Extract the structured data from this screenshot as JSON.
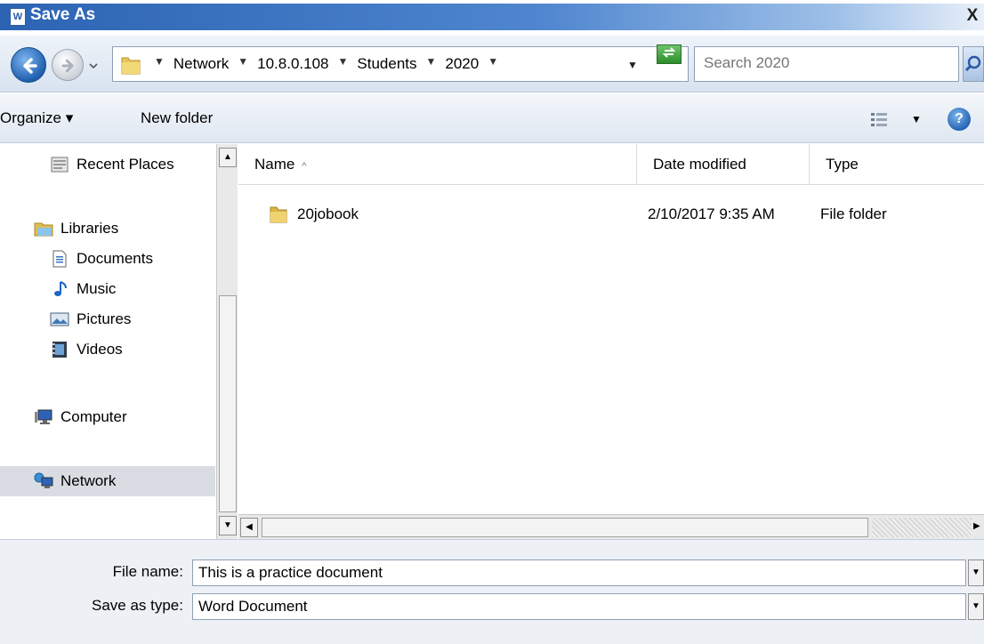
{
  "window": {
    "title": "Save As",
    "app_icon": "word-icon",
    "close_label": "X"
  },
  "address": {
    "crumbs": [
      "Network",
      "10.8.0.108",
      "Students",
      "2020"
    ],
    "search_placeholder": "Search 2020"
  },
  "toolbar": {
    "organize_label": "Organize ▾",
    "new_folder_label": "New folder",
    "help_label": "?"
  },
  "navigation": {
    "items": [
      {
        "label": "Recent Places",
        "icon": "recent-places-icon"
      },
      {
        "label": "Libraries",
        "icon": "libraries-icon"
      },
      {
        "label": "Documents",
        "icon": "documents-icon"
      },
      {
        "label": "Music",
        "icon": "music-icon"
      },
      {
        "label": "Pictures",
        "icon": "pictures-icon"
      },
      {
        "label": "Videos",
        "icon": "videos-icon"
      },
      {
        "label": "Computer",
        "icon": "computer-icon"
      },
      {
        "label": "Network",
        "icon": "network-icon"
      }
    ],
    "selected": "Network"
  },
  "files": {
    "columns": [
      "Name",
      "Date modified",
      "Type"
    ],
    "rows": [
      {
        "name": "20jobook",
        "date": "2/10/2017 9:35 AM",
        "type": "File folder",
        "icon": "folder-icon"
      }
    ]
  },
  "form": {
    "file_name_label": "File name:",
    "file_name_value": "This is a practice document",
    "save_type_label": "Save as type:",
    "save_type_value": "Word Document"
  },
  "colors": {
    "title_bar": "#2c63b3",
    "selection": "#d9dde3",
    "field_border": "#8e9fb4"
  }
}
